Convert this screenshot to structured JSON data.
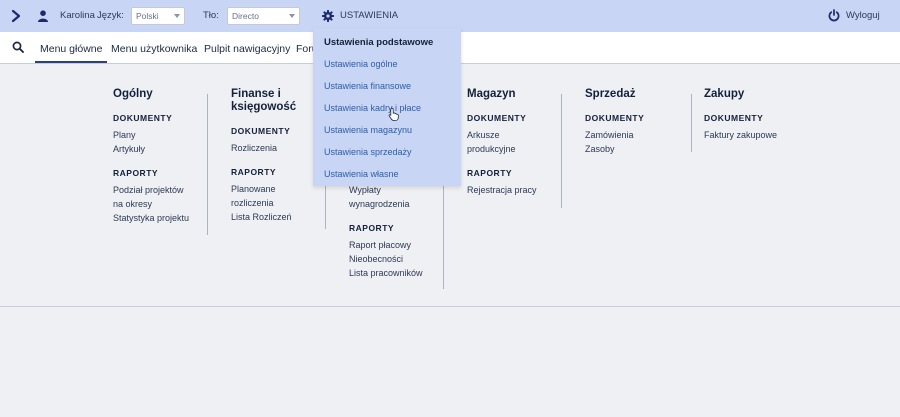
{
  "topbar": {
    "username": "Karolina",
    "language_label": "Język:",
    "language_value": "Polski",
    "type_label": "Tło:",
    "type_value": "Directo",
    "settings_label": "USTAWIENIA",
    "logout_label": "Wyloguj"
  },
  "nav": {
    "tabs": [
      "Menu główne",
      "Menu użytkownika",
      "Pulpit nawigacyjny",
      "Foru"
    ]
  },
  "settings_menu": {
    "header": "Ustawienia podstawowe",
    "items": [
      "Ustawienia ogólne",
      "Ustawienia finansowe",
      "Ustawienia kadry i płace",
      "Ustawienia magazynu",
      "Ustawienia sprzedaży",
      "Ustawienia własne"
    ]
  },
  "columns": {
    "ogolny": {
      "title": "Ogólny",
      "sec1": "DOKUMENTY",
      "sec1_items": [
        "Plany",
        "Artykuły"
      ],
      "sec2": "RAPORTY",
      "sec2_items": [
        "Podział projektów",
        "na okresy",
        "Statystyka projektu"
      ]
    },
    "finanse": {
      "title1": "Finanse i",
      "title2": "księgowość",
      "sec1": "DOKUMENTY",
      "sec1_items": [
        "Rozliczenia"
      ],
      "sec2": "RAPORTY",
      "sec2_items": [
        "Planowane",
        "rozliczenia",
        "Lista Rozliczeń"
      ]
    },
    "kadry": {
      "visible_items": [
        "Wypłaty",
        "wynagrodzenia"
      ],
      "sec2": "RAPORTY",
      "sec2_items": [
        "Raport płacowy",
        "Nieobecności",
        "Lista pracowników"
      ]
    },
    "magazyn": {
      "title": "Magazyn",
      "sec1": "DOKUMENTY",
      "sec1_items": [
        "Arkusze",
        "produkcyjne"
      ],
      "sec2": "RAPORTY",
      "sec2_items": [
        "Rejestracja pracy"
      ]
    },
    "sprzedaz": {
      "title": "Sprzedaż",
      "sec1": "DOKUMENTY",
      "sec1_items": [
        "Zamówienia",
        "Zasoby"
      ]
    },
    "zakupy": {
      "title": "Zakupy",
      "sec1": "DOKUMENTY",
      "sec1_items": [
        "Faktury zakupowe"
      ]
    }
  }
}
